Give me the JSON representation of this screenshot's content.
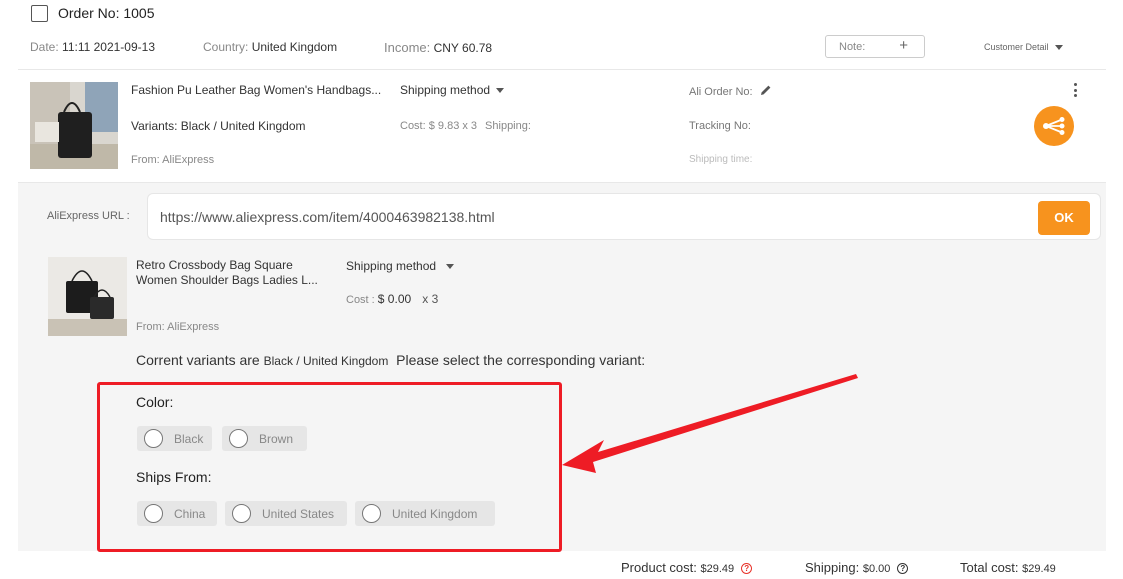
{
  "order": {
    "title": "Order No: 1005",
    "date_label": "Date:",
    "date_value": "11:11 2021-09-13",
    "country_label": "Country:",
    "country_value": "United Kingdom",
    "income_label": "Income:",
    "income_value": "CNY 60.78",
    "note_label": "Note:",
    "note_add": "+",
    "customer_detail": "Customer Detail"
  },
  "product": {
    "title": "Fashion Pu Leather Bag Women's Handbags...",
    "variants": "Variants: Black / United Kingdom",
    "from": "From: AliExpress",
    "shipping_method": "Shipping method",
    "cost": "Cost: $ 9.83 x 3",
    "shipping": "Shipping:",
    "ali_order": "Ali Order No:",
    "tracking": "Tracking No:",
    "shipping_time": "Shipping time:"
  },
  "edit": {
    "url_label": "AliExpress URL :",
    "url_value": "https://www.aliexpress.com/item/4000463982138.html",
    "ok": "OK",
    "sub_title": "Retro Crossbody Bag Square Women Shoulder Bags Ladies L...",
    "sub_from": "From: AliExpress",
    "sub_ship": "Shipping method",
    "sub_cost_label": "Cost :",
    "sub_cost_value": "$ 0.00",
    "sub_qty": "x 3",
    "current_prefix": "Corrent variants are",
    "current_value": "Black / United Kingdom",
    "current_suffix": "Please select the corresponding variant:",
    "color_label": "Color:",
    "colors": [
      "Black",
      "Brown"
    ],
    "ships_label": "Ships From:",
    "ships": [
      "China",
      "United States",
      "United Kingdom"
    ]
  },
  "footer": {
    "product_cost_label": "Product cost:",
    "product_cost_value": "$29.49",
    "shipping_label": "Shipping:",
    "shipping_value": "$0.00",
    "total_label": "Total cost:",
    "total_value": "$29.49"
  },
  "colors": {
    "accent": "#f7931e",
    "annotation": "#ee1c25",
    "panel_bg": "#f5f5f5"
  }
}
